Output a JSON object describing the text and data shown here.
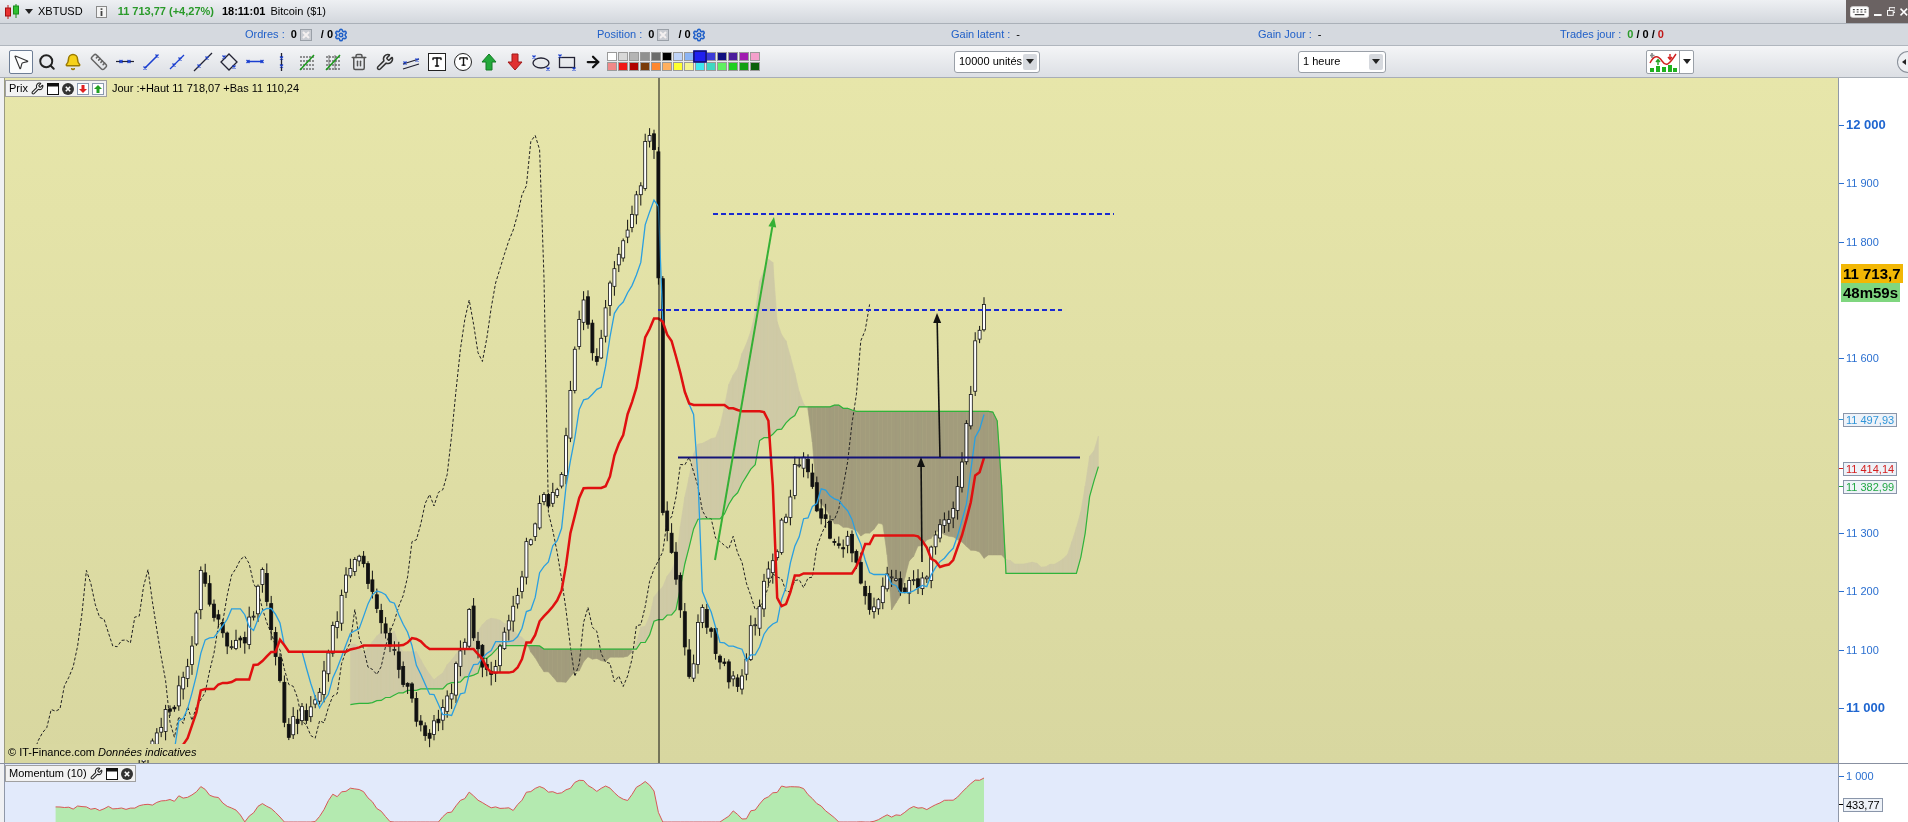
{
  "title_bar": {
    "symbol": "XBTUSD",
    "quote": "11 713,77 (+4,27%)",
    "time": "18:11:01",
    "name": "Bitcoin ($1)"
  },
  "account_bar": {
    "items": [
      {
        "kind": "orders",
        "label": "Ordres :",
        "value": "0",
        "total": "/ 0"
      },
      {
        "kind": "orders",
        "label": "Position :",
        "value": "0",
        "total": "/ 0"
      },
      {
        "kind": "plain",
        "label": "Gain latent :",
        "value": "-"
      },
      {
        "kind": "plain",
        "label": "Gain Jour :",
        "value": "-"
      },
      {
        "kind": "counts",
        "label": "Trades jour :",
        "parts": [
          {
            "text": "0",
            "color": "#2a9a2a"
          },
          {
            "text": "/",
            "color": "#000000"
          },
          {
            "text": "0",
            "color": "#000000"
          },
          {
            "text": "/",
            "color": "#000000"
          },
          {
            "text": "0",
            "color": "#c01818"
          }
        ]
      }
    ]
  },
  "toolbar": {
    "tools": [
      {
        "kind": "pointer",
        "selected": true
      },
      {
        "kind": "zoom",
        "selected": false
      },
      {
        "kind": "alert",
        "selected": false
      },
      {
        "kind": "ruler",
        "selected": false
      },
      {
        "kind": "hline",
        "selected": false
      },
      {
        "kind": "segment",
        "selected": false
      },
      {
        "kind": "line",
        "selected": false
      },
      {
        "kind": "ray",
        "selected": false
      },
      {
        "kind": "rhombus",
        "selected": false
      },
      {
        "kind": "hsegment",
        "selected": false
      },
      {
        "kind": "vline",
        "selected": false
      },
      {
        "kind": "fibonacci",
        "selected": false
      },
      {
        "kind": "fibfan",
        "selected": false
      },
      {
        "kind": "trash",
        "selected": false
      },
      {
        "kind": "tools",
        "selected": false
      },
      {
        "kind": "channel",
        "selected": false
      },
      {
        "kind": "textbox",
        "selected": false
      },
      {
        "kind": "textbubble",
        "selected": false
      },
      {
        "kind": "buyarrow",
        "selected": false
      },
      {
        "kind": "sellarrow",
        "selected": false
      },
      {
        "kind": "ellipse",
        "selected": false
      },
      {
        "kind": "rectangle",
        "selected": false
      },
      {
        "kind": "arrow",
        "selected": false
      }
    ],
    "palette": [
      {
        "color": "#ffffff",
        "selected": false
      },
      {
        "color": "#d8d8d8",
        "selected": false
      },
      {
        "color": "#b4b4b4",
        "selected": false
      },
      {
        "color": "#909090",
        "selected": false
      },
      {
        "color": "#6c6c6c",
        "selected": false
      },
      {
        "color": "#000000",
        "selected": false
      },
      {
        "color": "#c0d4f8",
        "selected": false
      },
      {
        "color": "#8cb4f4",
        "selected": false
      },
      {
        "color": "#2020f0",
        "selected": true
      },
      {
        "color": "#3c3cd8",
        "selected": false
      },
      {
        "color": "#101080",
        "selected": false
      },
      {
        "color": "#4c1c9c",
        "selected": false
      },
      {
        "color": "#a01cb0",
        "selected": false
      },
      {
        "color": "#f4a0cc",
        "selected": false
      },
      {
        "color": "#f08888",
        "selected": false
      },
      {
        "color": "#f01818",
        "selected": false
      },
      {
        "color": "#b00000",
        "selected": false
      },
      {
        "color": "#7a3a08",
        "selected": false
      },
      {
        "color": "#ff8830",
        "selected": false
      },
      {
        "color": "#ffb060",
        "selected": false
      },
      {
        "color": "#ffff30",
        "selected": false
      },
      {
        "color": "#f4f490",
        "selected": false
      },
      {
        "color": "#40e8f0",
        "selected": false
      },
      {
        "color": "#40d8c0",
        "selected": false
      },
      {
        "color": "#60f060",
        "selected": false
      },
      {
        "color": "#20d020",
        "selected": false
      },
      {
        "color": "#10a010",
        "selected": false
      },
      {
        "color": "#086008",
        "selected": false
      }
    ],
    "quantity": {
      "value": "10000 unités"
    },
    "period": {
      "value": "1 heure"
    }
  },
  "price_panel": {
    "label": "Prix",
    "day_range": "Jour :+Haut 11 718,07 +Bas 11 110,24",
    "credit": "© IT-Finance.com *Données indicatives*",
    "ticks": [
      {
        "label": "12 000",
        "major": true
      },
      {
        "label": "11 900",
        "major": false
      },
      {
        "label": "11 800",
        "major": false
      },
      {
        "label": "11 600",
        "major": false
      },
      {
        "label": "11 300",
        "major": false
      },
      {
        "label": "11 200",
        "major": false
      },
      {
        "label": "11 100",
        "major": false
      },
      {
        "label": "11 000",
        "major": true
      }
    ],
    "markers": [
      {
        "kind": "badge",
        "label": "11 713,7",
        "color": "#f2b705"
      },
      {
        "kind": "badge",
        "label": "48m59s",
        "color": "#7fd67f"
      },
      {
        "kind": "line",
        "label": "11 497,93",
        "color": "#2f95d8"
      },
      {
        "kind": "line",
        "label": "11 414,14",
        "color": "#d42020"
      },
      {
        "kind": "line",
        "label": "11 382,99",
        "color": "#22a844"
      }
    ]
  },
  "momentum_panel": {
    "label": "Momentum (10)",
    "ticks": [
      {
        "label": "1 000",
        "major": false
      }
    ],
    "markers": [
      {
        "kind": "line",
        "label": "433,77",
        "color": "#000000"
      }
    ]
  }
}
